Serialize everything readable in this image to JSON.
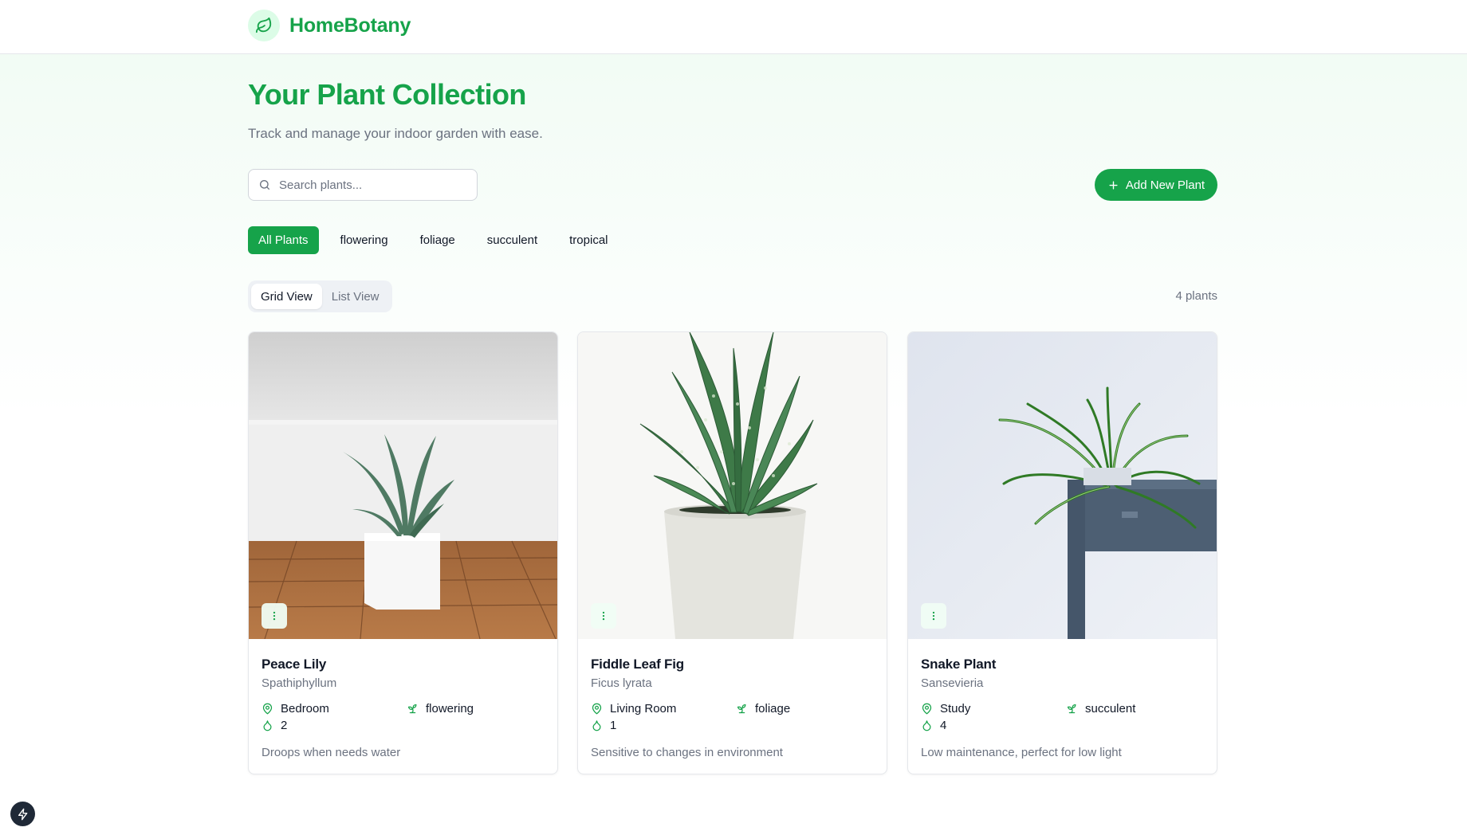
{
  "app": {
    "name": "HomeBotany",
    "logo_icon": "leaf-icon"
  },
  "page": {
    "title": "Your Plant Collection",
    "subtitle": "Track and manage your indoor garden with ease."
  },
  "search": {
    "placeholder": "Search plants...",
    "value": ""
  },
  "actions": {
    "add_label": "Add New Plant"
  },
  "filters": [
    {
      "label": "All Plants",
      "active": true
    },
    {
      "label": "flowering",
      "active": false
    },
    {
      "label": "foliage",
      "active": false
    },
    {
      "label": "succulent",
      "active": false
    },
    {
      "label": "tropical",
      "active": false
    }
  ],
  "view": {
    "grid_label": "Grid View",
    "list_label": "List View",
    "selected": "Grid View"
  },
  "count_label": "4 plants",
  "plants": [
    {
      "name": "Peace Lily",
      "scientific": "Spathiphyllum",
      "location": "Bedroom",
      "type": "flowering",
      "water": "2",
      "note": "Droops when needs water"
    },
    {
      "name": "Fiddle Leaf Fig",
      "scientific": "Ficus lyrata",
      "location": "Living Room",
      "type": "foliage",
      "water": "1",
      "note": "Sensitive to changes in environment"
    },
    {
      "name": "Snake Plant",
      "scientific": "Sansevieria",
      "location": "Study",
      "type": "succulent",
      "water": "4",
      "note": "Low maintenance, perfect for low light"
    }
  ],
  "colors": {
    "accent": "#16a34a",
    "accent_light": "#dcfce7",
    "muted_text": "#6b7280",
    "border": "#e5e7eb"
  }
}
